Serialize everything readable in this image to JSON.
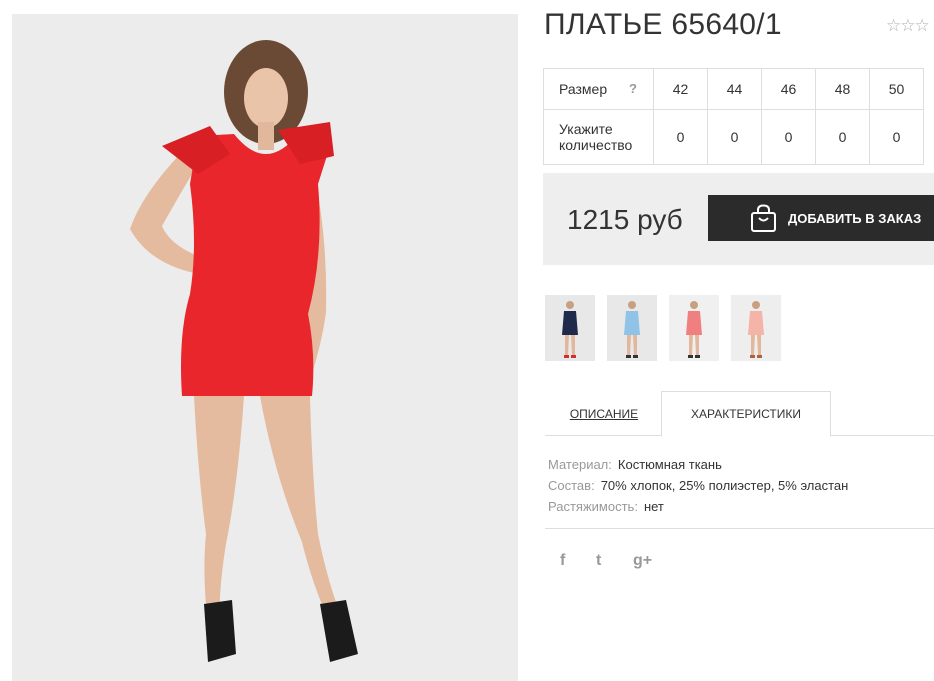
{
  "product": {
    "title": "ПЛАТЬЕ 65640/1",
    "rating_stars": "☆☆☆",
    "rating_value": 0
  },
  "sizes": {
    "row_label": "Размер",
    "help_label": "?",
    "values": [
      "42",
      "44",
      "46",
      "48",
      "50"
    ],
    "qty_label": "Укажите количество",
    "quantities": [
      "0",
      "0",
      "0",
      "0",
      "0"
    ]
  },
  "buy": {
    "price": "1215 руб",
    "add_button_label": "ДОБАВИТЬ В ЗАКАЗ"
  },
  "colors": {
    "thumbs": [
      "navy",
      "light-blue",
      "coral",
      "peach"
    ],
    "swatches": [
      "#1f2a4a",
      "#8fc3e8",
      "#f08080",
      "#f4b4a8"
    ],
    "accent": "#e8262b",
    "button_bg": "#2b2b2b"
  },
  "tabs": {
    "description": "ОПИСАНИЕ",
    "characteristics": "ХАРАКТЕРИСТИКИ",
    "active": "characteristics"
  },
  "specs": [
    {
      "key": "Материал:",
      "value": "Костюмная ткань"
    },
    {
      "key": "Состав:",
      "value": "70% хлопок, 25% полиэстер, 5% эластан"
    },
    {
      "key": "Растяжимость:",
      "value": "нет"
    }
  ],
  "social": {
    "facebook": "f",
    "twitter": "t",
    "googleplus": "g+"
  }
}
